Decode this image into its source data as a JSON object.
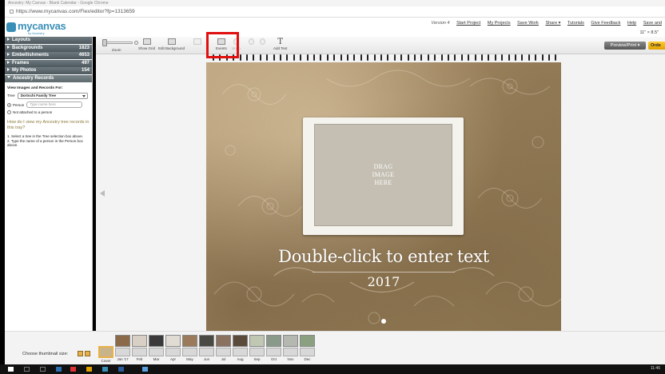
{
  "browser": {
    "title": "Ancestry: My Canvas - Blank Calendar - Google Chrome",
    "url": "https://www.mycanvas.com/Flex/editor?fp=1313659"
  },
  "app": {
    "logo_word": "mycanvas",
    "logo_sub": "by Ancestry",
    "version": "Version 4",
    "nav": [
      "Start Project",
      "My Projects",
      "Save Work",
      "Share ▾",
      "Tutorials",
      "Give Feedback",
      "Help",
      "Save and"
    ],
    "size_label": "11\" × 8.5\""
  },
  "sidebar": {
    "sections": [
      {
        "label": "Layouts",
        "count": ""
      },
      {
        "label": "Backgrounds",
        "count": "1823"
      },
      {
        "label": "Embellishments",
        "count": "4653"
      },
      {
        "label": "Frames",
        "count": "497"
      },
      {
        "label": "My Photos",
        "count": "154"
      },
      {
        "label": "Ancestry Records",
        "count": ""
      }
    ],
    "records": {
      "heading": "View Images and Records For:",
      "tree_label": "Tree",
      "tree_value": "Dortschi Family Tree",
      "person_label": "Person",
      "person_placeholder": "Type name here",
      "not_attached": "Not attached to a person",
      "help_link": "How do I view my Ancestry tree records in this tray?",
      "step1": "1. Select a tree in the Tree selection box above.",
      "step2": "2. Type the name of a person in the Person box above."
    }
  },
  "toolbar": {
    "zoom_label": "Zoom",
    "show_grid": "Show Grid",
    "edit_background": "Edit Background",
    "events": "Events",
    "undo": "Undo",
    "add_text": "Add Text",
    "preview": "Preview/Print ▾",
    "order": "Orde"
  },
  "canvas": {
    "drag_line1": "DRAG",
    "drag_line2": "IMAGE",
    "drag_line3": "HERE",
    "title_text": "Double-click to enter text",
    "year_text": "2017"
  },
  "thumbnails": {
    "size_label": "Choose thumbnail size:",
    "items": [
      "Cover",
      "Jan '17",
      "Feb",
      "Mar",
      "Apr",
      "May",
      "Jun",
      "Jul",
      "Aug",
      "Sep",
      "Oct",
      "Nov",
      "Dec"
    ]
  },
  "taskbar": {
    "clock": "11:46"
  },
  "colors": {
    "highlight": "#e01010",
    "accent": "#3a8fb7",
    "order_button": "#ffcc33"
  }
}
